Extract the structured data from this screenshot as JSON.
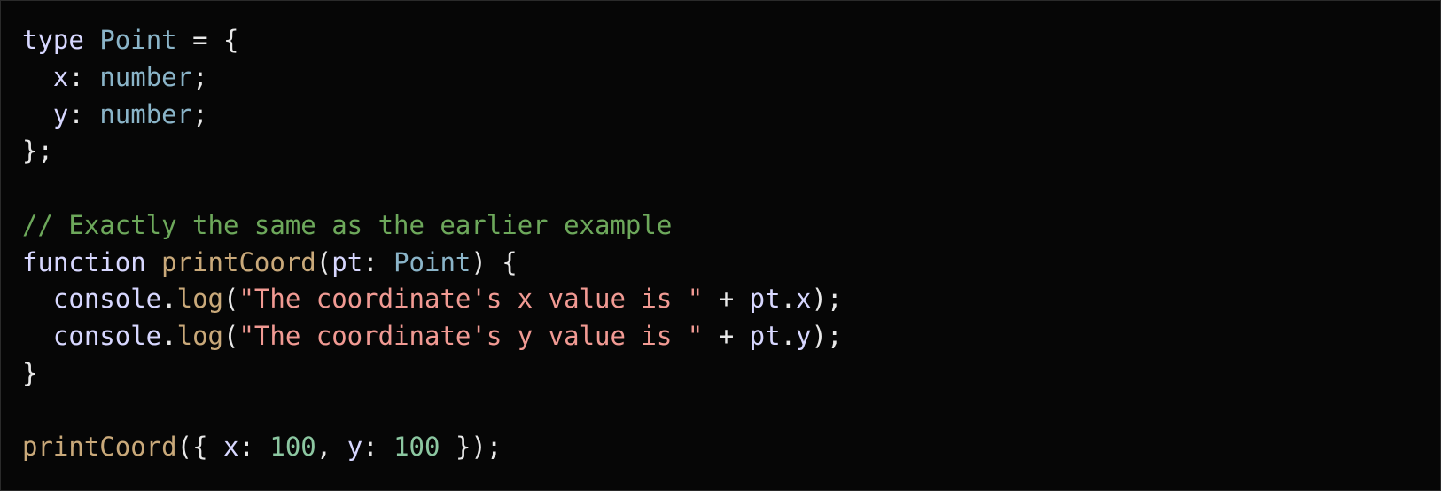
{
  "colors": {
    "background": "#060606",
    "plain": "#e8e8e8",
    "keyword": "#d7d7ff",
    "type": "#8ab4c8",
    "property": "#d7d7ff",
    "function": "#c9a97a",
    "comment": "#6da85b",
    "string": "#f19a93",
    "number": "#8cc7a1",
    "punctuation": "#e8e8e8"
  },
  "code": {
    "lines": [
      [
        {
          "t": "type",
          "k": "keyword"
        },
        {
          "t": " ",
          "k": "plain"
        },
        {
          "t": "Point",
          "k": "type"
        },
        {
          "t": " = {",
          "k": "punctuation"
        }
      ],
      [
        {
          "t": "  ",
          "k": "plain"
        },
        {
          "t": "x",
          "k": "property"
        },
        {
          "t": ": ",
          "k": "punctuation"
        },
        {
          "t": "number",
          "k": "type"
        },
        {
          "t": ";",
          "k": "punctuation"
        }
      ],
      [
        {
          "t": "  ",
          "k": "plain"
        },
        {
          "t": "y",
          "k": "property"
        },
        {
          "t": ": ",
          "k": "punctuation"
        },
        {
          "t": "number",
          "k": "type"
        },
        {
          "t": ";",
          "k": "punctuation"
        }
      ],
      [
        {
          "t": "};",
          "k": "punctuation"
        }
      ],
      [],
      [
        {
          "t": "// Exactly the same as the earlier example",
          "k": "comment"
        }
      ],
      [
        {
          "t": "function",
          "k": "keyword"
        },
        {
          "t": " ",
          "k": "plain"
        },
        {
          "t": "printCoord",
          "k": "function"
        },
        {
          "t": "(",
          "k": "punctuation"
        },
        {
          "t": "pt",
          "k": "property"
        },
        {
          "t": ": ",
          "k": "punctuation"
        },
        {
          "t": "Point",
          "k": "type"
        },
        {
          "t": ") {",
          "k": "punctuation"
        }
      ],
      [
        {
          "t": "  ",
          "k": "plain"
        },
        {
          "t": "console",
          "k": "property"
        },
        {
          "t": ".",
          "k": "punctuation"
        },
        {
          "t": "log",
          "k": "function"
        },
        {
          "t": "(",
          "k": "punctuation"
        },
        {
          "t": "\"The coordinate's x value is \"",
          "k": "string"
        },
        {
          "t": " + ",
          "k": "punctuation"
        },
        {
          "t": "pt",
          "k": "property"
        },
        {
          "t": ".",
          "k": "punctuation"
        },
        {
          "t": "x",
          "k": "property"
        },
        {
          "t": ");",
          "k": "punctuation"
        }
      ],
      [
        {
          "t": "  ",
          "k": "plain"
        },
        {
          "t": "console",
          "k": "property"
        },
        {
          "t": ".",
          "k": "punctuation"
        },
        {
          "t": "log",
          "k": "function"
        },
        {
          "t": "(",
          "k": "punctuation"
        },
        {
          "t": "\"The coordinate's y value is \"",
          "k": "string"
        },
        {
          "t": " + ",
          "k": "punctuation"
        },
        {
          "t": "pt",
          "k": "property"
        },
        {
          "t": ".",
          "k": "punctuation"
        },
        {
          "t": "y",
          "k": "property"
        },
        {
          "t": ");",
          "k": "punctuation"
        }
      ],
      [
        {
          "t": "}",
          "k": "punctuation"
        }
      ],
      [],
      [
        {
          "t": "printCoord",
          "k": "function"
        },
        {
          "t": "({ ",
          "k": "punctuation"
        },
        {
          "t": "x",
          "k": "property"
        },
        {
          "t": ": ",
          "k": "punctuation"
        },
        {
          "t": "100",
          "k": "number"
        },
        {
          "t": ", ",
          "k": "punctuation"
        },
        {
          "t": "y",
          "k": "property"
        },
        {
          "t": ": ",
          "k": "punctuation"
        },
        {
          "t": "100",
          "k": "number"
        },
        {
          "t": " });",
          "k": "punctuation"
        }
      ]
    ]
  }
}
